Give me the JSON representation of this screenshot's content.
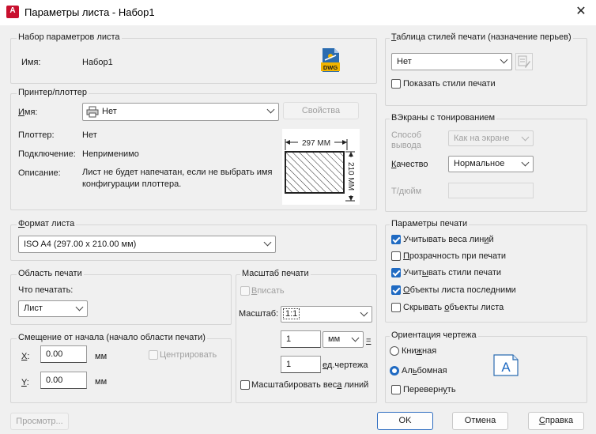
{
  "window": {
    "title": "Параметры листа - Набор1",
    "app_icon": "A",
    "close_glyph": "✕"
  },
  "pageset": {
    "group_title": "Набор параметров листа",
    "name_label": "Имя:",
    "name_value": "Набор1",
    "icon_text": "DWG"
  },
  "printer": {
    "group_title": "Принтер/плоттер",
    "name_label": "Имя:",
    "name_value": "Нет",
    "properties_button": "Свойства",
    "plotter_label": "Плоттер:",
    "plotter_value": "Нет",
    "connection_label": "Подключение:",
    "connection_value": "Неприменимо",
    "description_label": "Описание:",
    "description_value": "Лист не будет напечатан, если не выбрать имя конфигурации плоттера.",
    "preview_width": "297 ММ",
    "preview_height": "210 ММ"
  },
  "paper_size": {
    "group_title": "Формат листа",
    "value": "ISO A4 (297.00 x 210.00 мм)"
  },
  "plot_area": {
    "group_title": "Область печати",
    "what_label": "Что печатать:",
    "what_value": "Лист"
  },
  "plot_offset": {
    "group_title": "Смещение от начала (начало области печати)",
    "x_label": "X:",
    "x_value": "0.00",
    "x_unit": "мм",
    "y_label": "Y:",
    "y_value": "0.00",
    "y_unit": "мм",
    "center_label": "Центрировать",
    "center_checked": false
  },
  "plot_scale": {
    "group_title": "Масштаб печати",
    "fit_label": "Вписать",
    "fit_checked": false,
    "scale_label": "Масштаб:",
    "scale_value": "1:1",
    "units_value": "1",
    "units_combo": "мм",
    "equals": "=",
    "drawing_units_value": "1",
    "drawing_units_label": "ед.чертежа",
    "scale_lineweights_label": "Масштабировать веса линий",
    "scale_lineweights_checked": false
  },
  "pen_table": {
    "group_title": "Таблица стилей печати (назначение перьев)",
    "value": "Нет",
    "show_styles_label": "Показать стили печати",
    "show_styles_checked": false
  },
  "shaded": {
    "group_title": "ВЭкраны с тонированием",
    "shade_label": "Способ вывода",
    "shade_value": "Как на экране",
    "quality_label": "Качество",
    "quality_value": "Нормальное",
    "dpi_label": "Т/дюйм",
    "dpi_value": ""
  },
  "plot_options": {
    "group_title": "Параметры печати",
    "items": [
      {
        "label": "Учитывать веса линий",
        "checked": true
      },
      {
        "label": "Прозрачность при печати",
        "checked": false
      },
      {
        "label": "Учитывать стили печати",
        "checked": true
      },
      {
        "label": "Объекты листа последними",
        "checked": true
      },
      {
        "label": "Скрывать объекты листа",
        "checked": false
      }
    ]
  },
  "orientation": {
    "group_title": "Ориентация чертежа",
    "portrait_label": "Книжная",
    "landscape_label": "Альбомная",
    "selected": "landscape",
    "upside_down_label": "Перевернуть",
    "upside_down_checked": false,
    "icon_letter": "A"
  },
  "buttons": {
    "preview": "Просмотр...",
    "ok": "OK",
    "cancel": "Отмена",
    "help": "Справка"
  }
}
